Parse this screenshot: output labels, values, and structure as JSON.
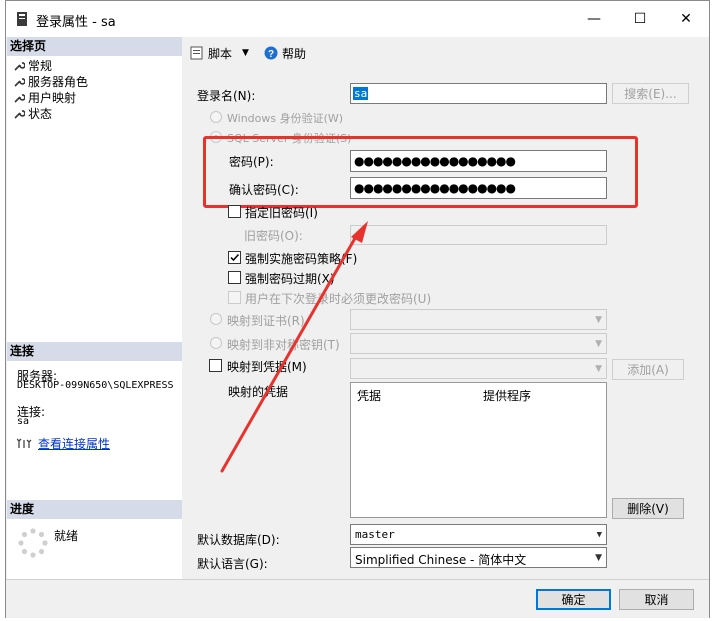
{
  "window": {
    "title": "登录属性 - sa",
    "controls": {
      "minimize": "—",
      "maximize": "☐",
      "close": "✕"
    }
  },
  "left": {
    "select_page_header": "选择页",
    "pages": [
      "常规",
      "服务器角色",
      "用户映射",
      "状态"
    ],
    "connection_header": "连接",
    "server_label": "服务器:",
    "server_value": "DESKTOP-099N650\\SQLEXPRESS",
    "conn_label": "连接:",
    "conn_value": "sa",
    "view_conn_props": "查看连接属性",
    "progress_header": "进度",
    "progress_status": "就绪"
  },
  "toolbar": {
    "script_label": "脚本",
    "help_label": "帮助"
  },
  "form": {
    "login_name_label": "登录名(N):",
    "login_name_value": "sa",
    "search_button": "搜索(E)...",
    "windows_auth": "Windows 身份验证(W)",
    "sql_auth": "SQL Server 身份验证(S)",
    "password_label": "密码(P):",
    "password_value": "●●●●●●●●●●●●●●●●●",
    "confirm_label": "确认密码(C):",
    "confirm_value": "●●●●●●●●●●●●●●●●●",
    "specify_old": "指定旧密码(I)",
    "old_password_label": "旧密码(O):",
    "enforce_policy": "强制实施密码策略(F)",
    "enforce_expiration": "强制密码过期(X)",
    "must_change": "用户在下次登录时必须更改密码(U)",
    "map_cert": "映射到证书(R)",
    "map_asym": "映射到非对称密钥(T)",
    "map_cred": "映射到凭据(M)",
    "add_button": "添加(A)",
    "mapped_creds_label": "映射的凭据",
    "cred_columns": [
      "凭据",
      "提供程序"
    ],
    "remove_button": "删除(V)",
    "default_db_label": "默认数据库(D):",
    "default_db_value": "master",
    "default_lang_label": "默认语言(G):",
    "default_lang_value": "Simplified Chinese - 简体中文"
  },
  "footer": {
    "ok_button": "确定",
    "cancel_button": "取消"
  },
  "colors": {
    "accent_red": "#e8322d",
    "link_blue": "#0033cc",
    "section_header_bg": "#d6dbe9"
  }
}
